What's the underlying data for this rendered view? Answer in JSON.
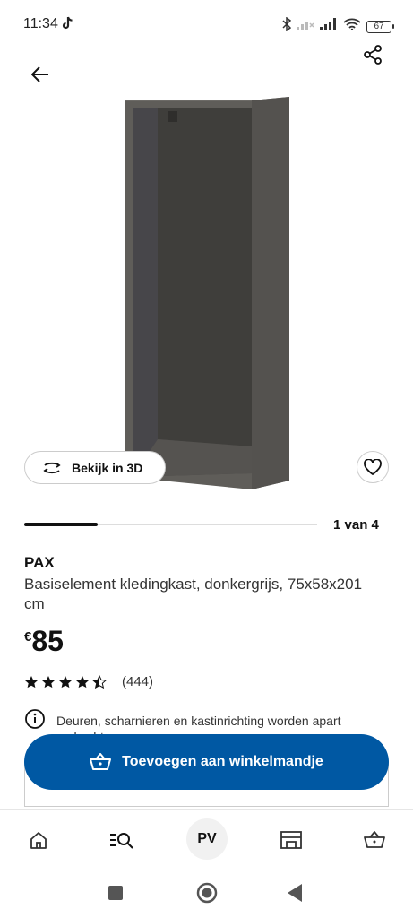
{
  "status_bar": {
    "time": "11:34",
    "battery": "67",
    "icons": [
      "tiktok-icon",
      "bluetooth-icon",
      "signal-icon",
      "wifi-icon",
      "battery-icon"
    ]
  },
  "header": {
    "back_icon": "arrow-left-icon",
    "share_icon": "share-icon"
  },
  "gallery": {
    "view3d_label": "Bekijk in 3D",
    "position_label": "1 van 4",
    "current": 1,
    "total": 4
  },
  "product": {
    "name": "PAX",
    "description": "Basiselement kledingkast, donkergrijs, 75x58x201 cm",
    "price_currency": "€",
    "price_amount": "85",
    "rating": 4.5,
    "review_count": "(444)",
    "info_text": "Deuren, scharnieren en kastinrichting worden apart verkocht"
  },
  "cart": {
    "add_label": "Toevoegen aan winkelmandje"
  },
  "bottom_nav": {
    "items": [
      "home-icon",
      "search-icon",
      "profile-avatar",
      "store-icon",
      "cart-icon"
    ],
    "avatar_initials": "PV"
  },
  "colors": {
    "accent": "#0058a3",
    "product": "#5f5d59"
  }
}
